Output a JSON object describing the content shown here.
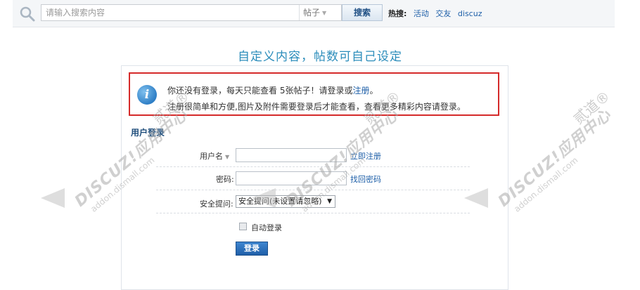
{
  "search": {
    "placeholder": "请输入搜索内容",
    "type_selected": "帖子",
    "button_label": "搜索",
    "hot_label": "热搜:",
    "hot_links": [
      "活动",
      "交友",
      "discuz"
    ]
  },
  "headline": "自定义内容，帖数可自己设定",
  "notice": {
    "line1_pre": "你还没有登录，每天只能查看 5张帖子！请登录或",
    "line1_link": "注册",
    "line1_post": "。",
    "line2": "注册很简单和方便,图片及附件需要登录后才能查看，查看更多精彩内容请登录。"
  },
  "login": {
    "section_title": "用户登录",
    "username_label": "用户名",
    "register_link": "立即注册",
    "password_label": "密码:",
    "forgot_link": "找回密码",
    "question_label": "安全提问:",
    "question_selected": "安全提问(未设置请忽略)",
    "autologin_label": "自动登录",
    "submit_label": "登录"
  },
  "watermark": {
    "brand": "DISCUZ!应用中心",
    "domain": "addon.dismall.com",
    "tag": "贰道®"
  },
  "colors": {
    "accent": "#2c8dbb",
    "link": "#1e5fa8",
    "notice_border": "#d52a2a",
    "button_blue": "#1f5fa9"
  }
}
